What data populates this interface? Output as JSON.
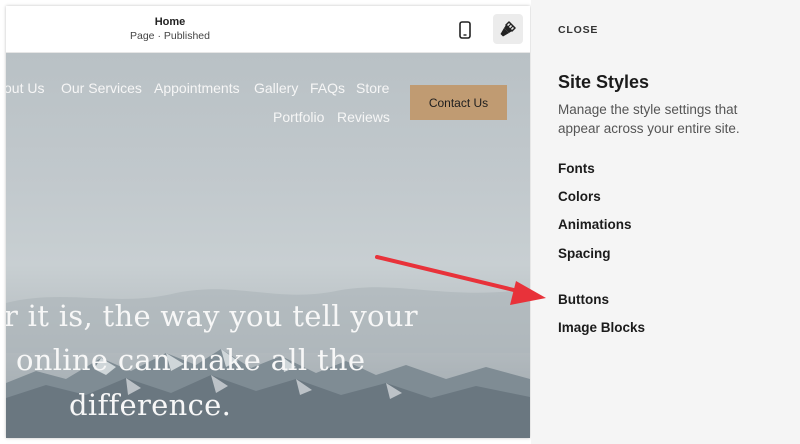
{
  "topbar": {
    "page_title": "Home",
    "page_status": "Page · Published"
  },
  "icons": {
    "mobile": "mobile-phone-icon",
    "brush": "paintbrush-icon",
    "arrow": "red-arrow-annotation"
  },
  "site_nav": {
    "items": [
      "out Us",
      "Our Services",
      "Appointments",
      "Gallery",
      "FAQs",
      "Store",
      "Portfolio",
      "Reviews"
    ],
    "cta_label": "Contact Us"
  },
  "hero": {
    "lines": [
      "r it is, the way you tell your",
      "online can make all the",
      "difference."
    ]
  },
  "panel": {
    "close_label": "CLOSE",
    "title": "Site Styles",
    "description": "Manage the style settings that appear across your entire site.",
    "items": [
      "Fonts",
      "Colors",
      "Animations",
      "Spacing",
      "Buttons",
      "Image Blocks"
    ]
  },
  "colors": {
    "cta_background": "#c09b72",
    "panel_background": "#f5f5f5",
    "annotation_arrow": "#e8323a"
  }
}
